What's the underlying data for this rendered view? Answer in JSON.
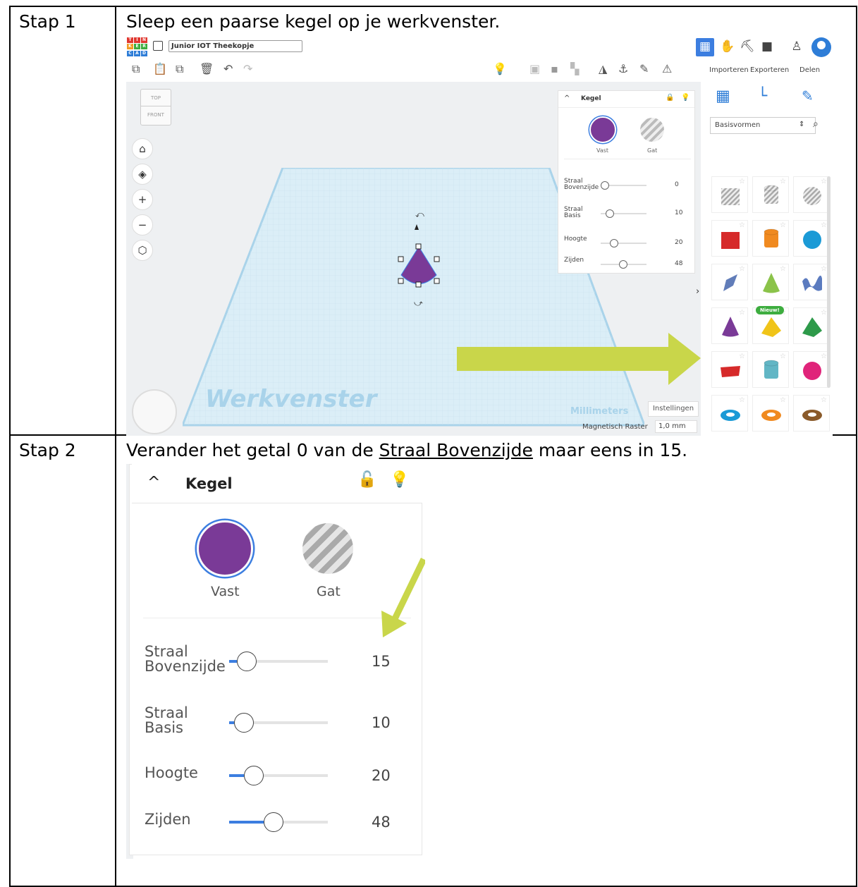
{
  "rows": [
    {
      "label": "Stap 1",
      "instruction": "Sleep een paarse kegel op je werkvenster."
    },
    {
      "label": "Stap 2",
      "instruction_pre": "Verander het getal 0 van de ",
      "instruction_link": "Straal Bovenzijde",
      "instruction_post": " maar eens in 15."
    }
  ],
  "tinkercad": {
    "logo_letters": [
      "T",
      "I",
      "N",
      "K",
      "E",
      "R",
      "C",
      "A",
      "D"
    ],
    "project_name": "Junior IOT Theekopje",
    "toolbar_links": {
      "import": "Importeren",
      "export": "Exporteren",
      "share": "Delen"
    },
    "viewcube": {
      "top": "TOP",
      "front": "FRONT"
    },
    "workplane_label": "Werkvenster",
    "units_label": "Millimeters",
    "settings_button": "Instellingen",
    "snap_grid_label": "Magnetisch Raster",
    "snap_grid_value": "1,0 mm",
    "library_select": "Basisvormen",
    "new_badge": "Nieuw!",
    "inspector": {
      "title": "Kegel",
      "solid": "Vast",
      "hole": "Gat",
      "params": [
        {
          "label_a": "Straal",
          "label_b": "Bovenzijde",
          "value": "0",
          "level": 0
        },
        {
          "label_a": "Straal",
          "label_b": "Basis",
          "value": "10",
          "level": 0.1
        },
        {
          "label_a": "Hoogte",
          "label_b": "",
          "value": "20",
          "level": 0.2
        },
        {
          "label_a": "Zijden",
          "label_b": "",
          "value": "48",
          "level": 0.4
        }
      ]
    }
  },
  "zoomed_inspector": {
    "title": "Kegel",
    "solid": "Vast",
    "hole": "Gat",
    "params": [
      {
        "label_a": "Straal",
        "label_b": "Bovenzijde",
        "value": "15",
        "level": 0.08
      },
      {
        "label_a": "Straal",
        "label_b": "Basis",
        "value": "10",
        "level": 0.05
      },
      {
        "label_a": "Hoogte",
        "label_b": "",
        "value": "20",
        "level": 0.15
      },
      {
        "label_a": "Zijden",
        "label_b": "",
        "value": "48",
        "level": 0.35
      }
    ]
  },
  "colors": {
    "purple": "#7a3a97",
    "accent": "#3c7ee0",
    "arrow": "#c9d64a",
    "grid": "#cfe6f2"
  }
}
